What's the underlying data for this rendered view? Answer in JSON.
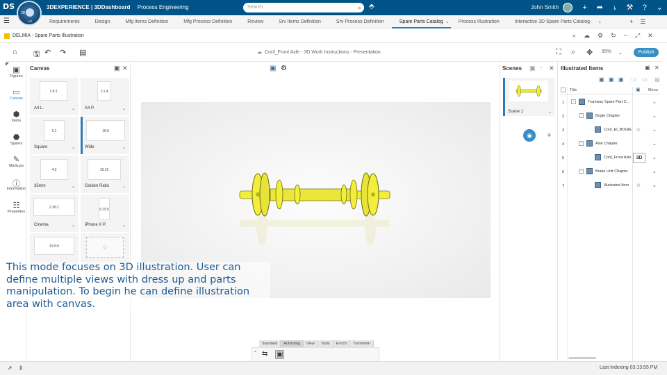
{
  "topbar": {
    "brand": "3DEXPERIENCE | 3DDashboard",
    "context": "Process Engineering",
    "search_placeholder": "Search",
    "compass_label": "3D",
    "compass_version": "V,R",
    "user_name": "John Smith",
    "icons": [
      "plus-icon",
      "share-icon",
      "share-network-icon",
      "tools-icon",
      "help-icon",
      "chevron-down-icon"
    ]
  },
  "tabs": [
    {
      "label": "Requirements"
    },
    {
      "label": "Design"
    },
    {
      "label": "Mfg Items Definition"
    },
    {
      "label": "Mfg Process Definition"
    },
    {
      "label": "Review"
    },
    {
      "label": "Srv Items Definition"
    },
    {
      "label": "Srv Process Definition"
    },
    {
      "label": "Spare Parts Catalog",
      "active": true
    },
    {
      "label": "Process Illustration"
    },
    {
      "label": "Interactive 3D Spare Parts Catalog"
    }
  ],
  "app": {
    "title": "DELMIA - Spare Parts Illustration"
  },
  "toolbar": {
    "document_title": "Conf_Front Axle - 3D Work Instructions - Presentation",
    "zoom": "95%",
    "publish_label": "Publish"
  },
  "rail": [
    {
      "label": "Figures",
      "icon": "figures-icon"
    },
    {
      "label": "Canvas",
      "icon": "canvas-icon",
      "active": true
    },
    {
      "label": "Items",
      "icon": "items-icon"
    },
    {
      "label": "Spares",
      "icon": "spares-icon"
    },
    {
      "label": "Markups",
      "icon": "markups-icon"
    },
    {
      "label": "Information",
      "icon": "information-icon"
    },
    {
      "label": "Properties",
      "icon": "properties-icon"
    }
  ],
  "canvas_panel": {
    "title": "Canvas",
    "cards": [
      {
        "ratio": "1:4:1",
        "label": "A4 L."
      },
      {
        "ratio": "1:1.4",
        "label": "A4 P."
      },
      {
        "ratio": "1:1",
        "label": "Square"
      },
      {
        "ratio": "16:9",
        "label": "Wide",
        "selected": true
      },
      {
        "ratio": "4:3",
        "label": "35mm"
      },
      {
        "ratio": "16:10",
        "label": "Golden Ratio"
      },
      {
        "ratio": "2.36:1",
        "label": "Cinema"
      },
      {
        "ratio": "9:19.5",
        "label": "iPhone X P."
      },
      {
        "ratio": "19.5:9",
        "label": ""
      },
      {
        "ratio": "",
        "label": ""
      }
    ]
  },
  "caption": "This mode focuses on 3D illustration. User can define multiple views with dress up and parts manipulation. To begin he can define illustration area with canvas.",
  "ribbon": {
    "tabs": [
      "Standard",
      "Authoring",
      "View",
      "Tools",
      "Enrich",
      "Transform"
    ],
    "active_tab": "Authoring"
  },
  "scenes": {
    "title": "Scenes",
    "items": [
      {
        "label": "Scene 1"
      }
    ]
  },
  "illustrated_items": {
    "title": "Illustrated Items",
    "columns": [
      "Title",
      "Menu"
    ],
    "rows": [
      {
        "num": "1",
        "title": "Tramway Spare Part C...",
        "level": 0,
        "expander": "-"
      },
      {
        "num": "2",
        "title": "Bogie Chapter",
        "level": 1,
        "expander": "-"
      },
      {
        "num": "3",
        "title": "Conf_El_BOGIE",
        "level": 2,
        "expander": ""
      },
      {
        "num": "4",
        "title": "Axle Chapter",
        "level": 1,
        "expander": "-"
      },
      {
        "num": "5",
        "title": "Conf_Front Axle",
        "level": 2,
        "expander": "",
        "badge": "3D"
      },
      {
        "num": "6",
        "title": "Brake Unit Chapter",
        "level": 1,
        "expander": "-"
      },
      {
        "num": "7",
        "title": "Illustrated Item",
        "level": 2,
        "expander": ""
      }
    ]
  },
  "status": {
    "text": "Last Indexing  03:13:55 PM"
  },
  "colors": {
    "header": "#005386",
    "accent": "#368ec4",
    "caption": "#1f5a93",
    "axle": "#f2ee3a"
  }
}
